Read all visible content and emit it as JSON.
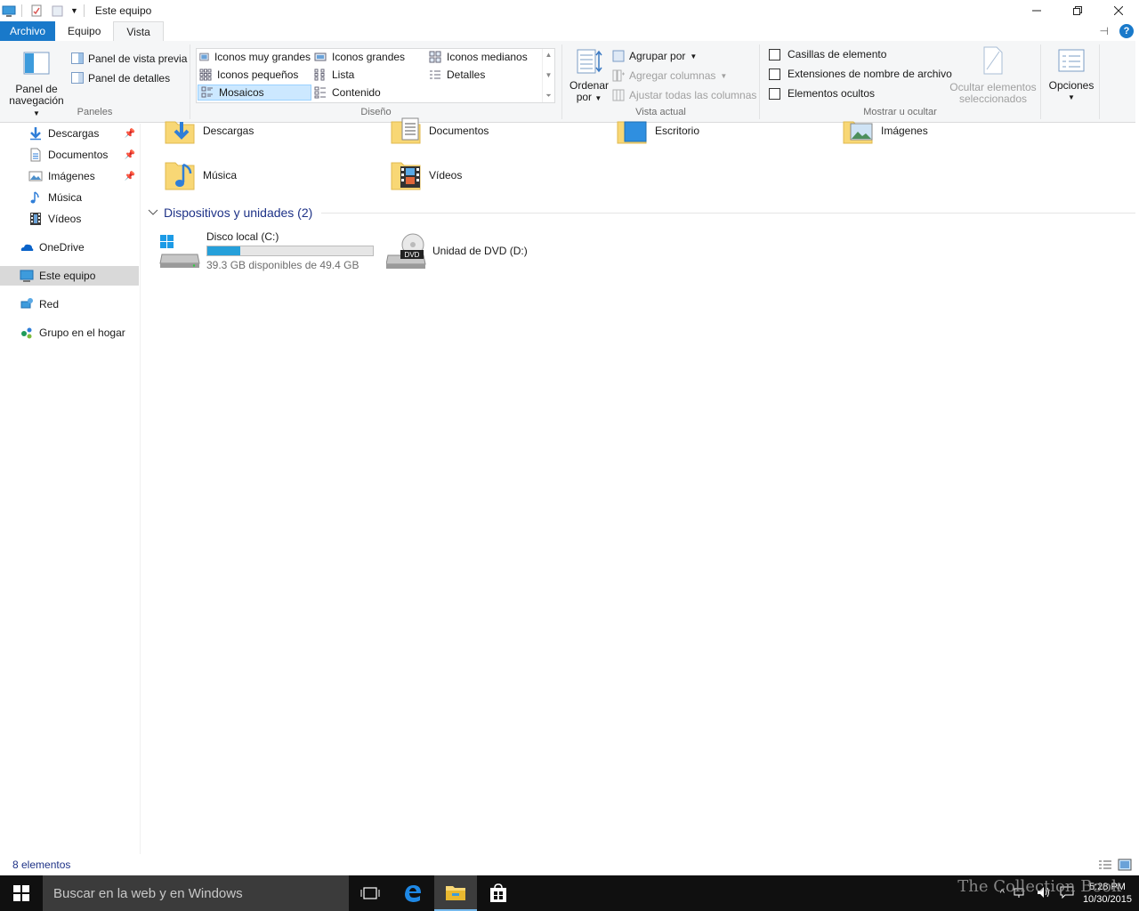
{
  "window": {
    "title": "Este equipo",
    "controls": [
      "minimize",
      "restore",
      "close"
    ]
  },
  "ribbon_tabs": [
    {
      "label": "Archivo"
    },
    {
      "label": "Equipo"
    },
    {
      "label": "Vista"
    }
  ],
  "ribbon": {
    "paneles": {
      "label": "Paneles",
      "nav_pane_line1": "Panel de",
      "nav_pane_line2": "navegación",
      "preview_pane": "Panel de vista previa",
      "details_pane": "Panel de detalles"
    },
    "diseno": {
      "label": "Diseño",
      "items": [
        {
          "label": "Iconos muy grandes"
        },
        {
          "label": "Iconos grandes"
        },
        {
          "label": "Iconos medianos"
        },
        {
          "label": "Iconos pequeños"
        },
        {
          "label": "Lista"
        },
        {
          "label": "Detalles"
        },
        {
          "label": "Mosaicos"
        },
        {
          "label": "Contenido"
        }
      ],
      "selected": "Mosaicos"
    },
    "vista_actual": {
      "label": "Vista actual",
      "sort_line1": "Ordenar",
      "sort_line2": "por",
      "group_by": "Agrupar por",
      "add_columns": "Agregar columnas",
      "fit_columns": "Ajustar todas las columnas"
    },
    "mostrar": {
      "label": "Mostrar u ocultar",
      "item_checkboxes": "Casillas de elemento",
      "file_extensions": "Extensiones de nombre de archivo",
      "hidden_items": "Elementos ocultos",
      "hide_selected_line1": "Ocultar elementos",
      "hide_selected_line2": "seleccionados"
    },
    "options": "Opciones"
  },
  "nav_pane": {
    "items": [
      {
        "label": "Descargas",
        "pinned": true
      },
      {
        "label": "Documentos",
        "pinned": true
      },
      {
        "label": "Imágenes",
        "pinned": true
      },
      {
        "label": "Música",
        "pinned": false
      },
      {
        "label": "Vídeos",
        "pinned": false
      },
      {
        "label": "OneDrive",
        "pinned": false
      },
      {
        "label": "Este equipo",
        "pinned": false,
        "selected": true
      },
      {
        "label": "Red",
        "pinned": false
      },
      {
        "label": "Grupo en el hogar",
        "pinned": false
      }
    ]
  },
  "content": {
    "folders": [
      {
        "label": "Descargas"
      },
      {
        "label": "Documentos"
      },
      {
        "label": "Escritorio"
      },
      {
        "label": "Imágenes"
      },
      {
        "label": "Música"
      },
      {
        "label": "Vídeos"
      }
    ],
    "devices_section": "Dispositivos y unidades (2)",
    "drives": [
      {
        "label": "Disco local (C:)",
        "space": "39.3 GB disponibles de 49.4 GB",
        "used_fraction": 0.2
      },
      {
        "label": "Unidad de DVD (D:)"
      }
    ]
  },
  "status": {
    "item_count": "8 elementos"
  },
  "taskbar": {
    "search_placeholder": "Buscar en la web y en Windows",
    "time": "5:28 PM",
    "date": "10/30/2015",
    "watermark": "The Collection Book"
  },
  "colors": {
    "accent": "#1979ca",
    "selection": "#cce8ff",
    "folder": "#f8d775",
    "drive_fill": "#26a0da",
    "section_title": "#1e3287"
  }
}
